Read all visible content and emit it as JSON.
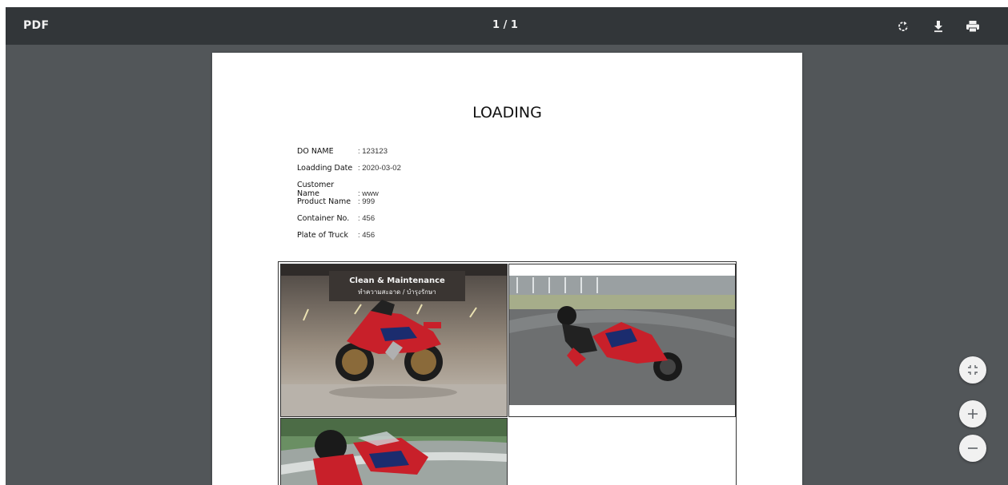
{
  "toolbar": {
    "title": "PDF",
    "page_indicator": "1 / 1",
    "rotate_icon": "rotate-icon",
    "download_icon": "download-icon",
    "print_icon": "print-icon"
  },
  "document": {
    "title": "LOADING",
    "fields": [
      {
        "label": "DO NAME",
        "value": ": 123123"
      },
      {
        "label": "Loadding Date",
        "value": ": 2020-03-02"
      },
      {
        "label": "Customer Name",
        "value": ": www"
      },
      {
        "label": "Product Name",
        "value": ": 999"
      },
      {
        "label": "Container No.",
        "value": ": 456"
      },
      {
        "label": "Plate of Truck",
        "value": ": 456"
      }
    ],
    "photo_banner": {
      "line1": "Clean & Maintenance",
      "line2": "ทำความสะอาด / บำรุงรักษา"
    }
  },
  "zoom_controls": {
    "fit_icon": "fit-to-page-icon",
    "zoom_in_icon": "zoom-in-icon",
    "zoom_out_icon": "zoom-out-icon"
  },
  "colors": {
    "viewer_bg": "#525659",
    "toolbar_bg": "#323639",
    "motorcycle_red": "#c8202a"
  }
}
